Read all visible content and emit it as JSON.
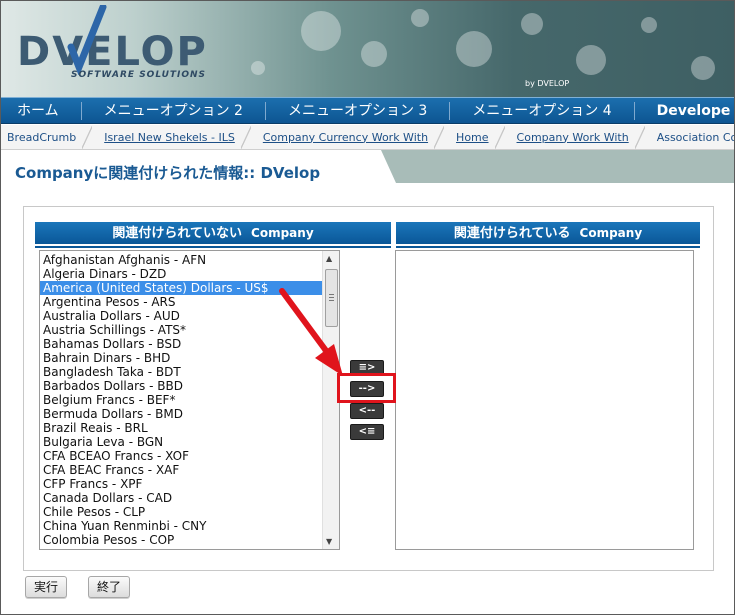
{
  "logo": {
    "text": "DVELOP",
    "subtitle": "SOFTWARE SOLUTIONS",
    "mark": "by DVELOP"
  },
  "nav": [
    "ホーム",
    "メニューオプション 2",
    "メニューオプション 3",
    "メニューオプション 4",
    "Develope"
  ],
  "breadcrumb": [
    "BreadCrumb",
    "Israel New Shekels - ILS",
    "Company Currency Work With",
    "Home",
    "Company Work With",
    "Association Co"
  ],
  "page_title": "Companyに関連付けられた情報:: DVelop",
  "left_header": {
    "main": "関連付けられていない",
    "entity": "Company"
  },
  "right_header": {
    "main": "関連付けられている",
    "entity": "Company"
  },
  "unassociated": [
    "Afghanistan Afghanis - AFN",
    "Algeria Dinars - DZD",
    "America (United States) Dollars - US$",
    "Argentina Pesos - ARS",
    "Australia Dollars - AUD",
    "Austria Schillings - ATS*",
    "Bahamas Dollars - BSD",
    "Bahrain Dinars - BHD",
    "Bangladesh Taka - BDT",
    "Barbados Dollars - BBD",
    "Belgium Francs - BEF*",
    "Bermuda Dollars - BMD",
    "Brazil Reais - BRL",
    "Bulgaria Leva - BGN",
    "CFA BCEAO Francs - XOF",
    "CFA BEAC Francs - XAF",
    "CFP Francs - XPF",
    "Canada Dollars - CAD",
    "Chile Pesos - CLP",
    "China Yuan Renminbi - CNY",
    "Colombia Pesos - COP"
  ],
  "selected_index": 2,
  "move_buttons": {
    "add_all": "≡>",
    "add": "-->",
    "remove": "<--",
    "remove_all": "<≡"
  },
  "footer": {
    "execute": "実行",
    "close": "終了"
  }
}
